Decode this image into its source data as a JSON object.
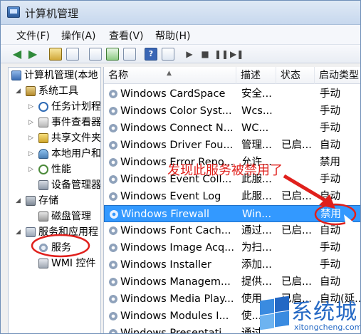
{
  "window": {
    "title": "计算机管理"
  },
  "menu": [
    "文件(F)",
    "操作(A)",
    "查看(V)",
    "帮助(H)"
  ],
  "toolbar": {
    "help_glyph": "?"
  },
  "tree": [
    {
      "label": "计算机管理(本地",
      "icon": "computer-management-icon"
    },
    {
      "label": "系统工具",
      "icon": "system-tools-icon"
    },
    {
      "label": "任务计划程",
      "icon": "task-scheduler-icon"
    },
    {
      "label": "事件查看器",
      "icon": "event-viewer-icon"
    },
    {
      "label": "共享文件夹",
      "icon": "shared-folders-icon"
    },
    {
      "label": "本地用户和",
      "icon": "local-users-icon"
    },
    {
      "label": "性能",
      "icon": "performance-icon"
    },
    {
      "label": "设备管理器",
      "icon": "device-manager-icon"
    },
    {
      "label": "存储",
      "icon": "storage-icon"
    },
    {
      "label": "磁盘管理",
      "icon": "disk-management-icon"
    },
    {
      "label": "服务和应用程",
      "icon": "services-applications-icon"
    },
    {
      "label": "服务",
      "icon": "services-gear-icon"
    },
    {
      "label": "WMI 控件",
      "icon": "wmi-control-icon"
    }
  ],
  "columns": [
    "名称",
    "描述",
    "状态",
    "启动类型"
  ],
  "services": [
    {
      "name": "Windows CardSpace",
      "desc": "安全...",
      "status": "",
      "startup": "手动"
    },
    {
      "name": "Windows Color Syst...",
      "desc": "Wcs...",
      "status": "",
      "startup": "手动"
    },
    {
      "name": "Windows Connect N...",
      "desc": "WC...",
      "status": "",
      "startup": "手动"
    },
    {
      "name": "Windows Driver Fou...",
      "desc": "管理...",
      "status": "已启...",
      "startup": "自动"
    },
    {
      "name": "Windows Error Repo...",
      "desc": "允许...",
      "status": "",
      "startup": "禁用"
    },
    {
      "name": "Windows Event Coll...",
      "desc": "此服...",
      "status": "",
      "startup": "手动"
    },
    {
      "name": "Windows Event Log",
      "desc": "此服...",
      "status": "已启...",
      "startup": "自动"
    },
    {
      "name": "Windows Firewall",
      "desc": "Win...",
      "status": "",
      "startup": "禁用"
    },
    {
      "name": "Windows Font Cach...",
      "desc": "通过...",
      "status": "已启...",
      "startup": "自动"
    },
    {
      "name": "Windows Image Acq...",
      "desc": "为扫...",
      "status": "",
      "startup": "手动"
    },
    {
      "name": "Windows Installer",
      "desc": "添加...",
      "status": "",
      "startup": "手动"
    },
    {
      "name": "Windows Managem...",
      "desc": "提供...",
      "status": "已启...",
      "startup": "自动"
    },
    {
      "name": "Windows Media Play...",
      "desc": "使用...",
      "status": "已启...",
      "startup": "自动(延..."
    },
    {
      "name": "Windows Modules I...",
      "desc": "使...",
      "status": "",
      "startup": ""
    },
    {
      "name": "Windows Presentati...",
      "desc": "通过...",
      "status": "",
      "startup": ""
    }
  ],
  "selected_service": "Windows Firewall",
  "annotation": {
    "text": "发现此服务被禁用了",
    "color": "#e0201c"
  },
  "colors": {
    "selection": "#3399ff",
    "annotation_red": "#e0201c",
    "watermark_blue": "#2468c4"
  },
  "watermark": {
    "brand": "系统城",
    "url": "xitongcheng.com"
  }
}
